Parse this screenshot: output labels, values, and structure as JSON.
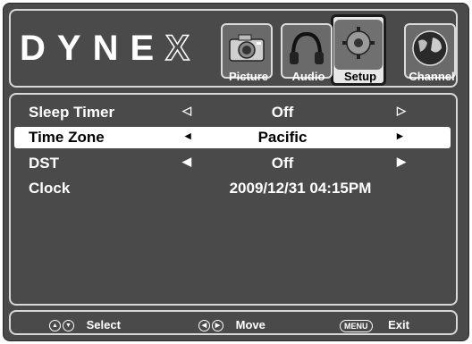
{
  "brand": {
    "logo_main": "DYNE",
    "logo_last": "X"
  },
  "tabs": [
    {
      "label": "Picture",
      "icon": "camera-icon"
    },
    {
      "label": "Audio",
      "icon": "headphones-icon"
    },
    {
      "label": "Setup",
      "icon": "gear-icon",
      "active": true
    },
    {
      "label": "Channel",
      "icon": "globe-icon"
    }
  ],
  "menu": {
    "items": [
      {
        "label": "Sleep Timer",
        "value": "Off",
        "arrow_left": "◁",
        "arrow_right": "▷"
      },
      {
        "label": "Time Zone",
        "value": "Pacific",
        "arrow_left": "◂",
        "arrow_right": "▸",
        "selected": true
      },
      {
        "label": "DST",
        "value": "Off",
        "arrow_left": "◀",
        "arrow_right": "▶"
      },
      {
        "label": "Clock",
        "value": "2009/12/31 04:15PM"
      }
    ]
  },
  "footer": {
    "select_label": "Select",
    "move_label": "Move",
    "menu_button": "MENU",
    "exit_label": "Exit"
  },
  "colors": {
    "background": "#4a4a4a",
    "highlight": "#ffffff",
    "text": "#ffffff"
  }
}
